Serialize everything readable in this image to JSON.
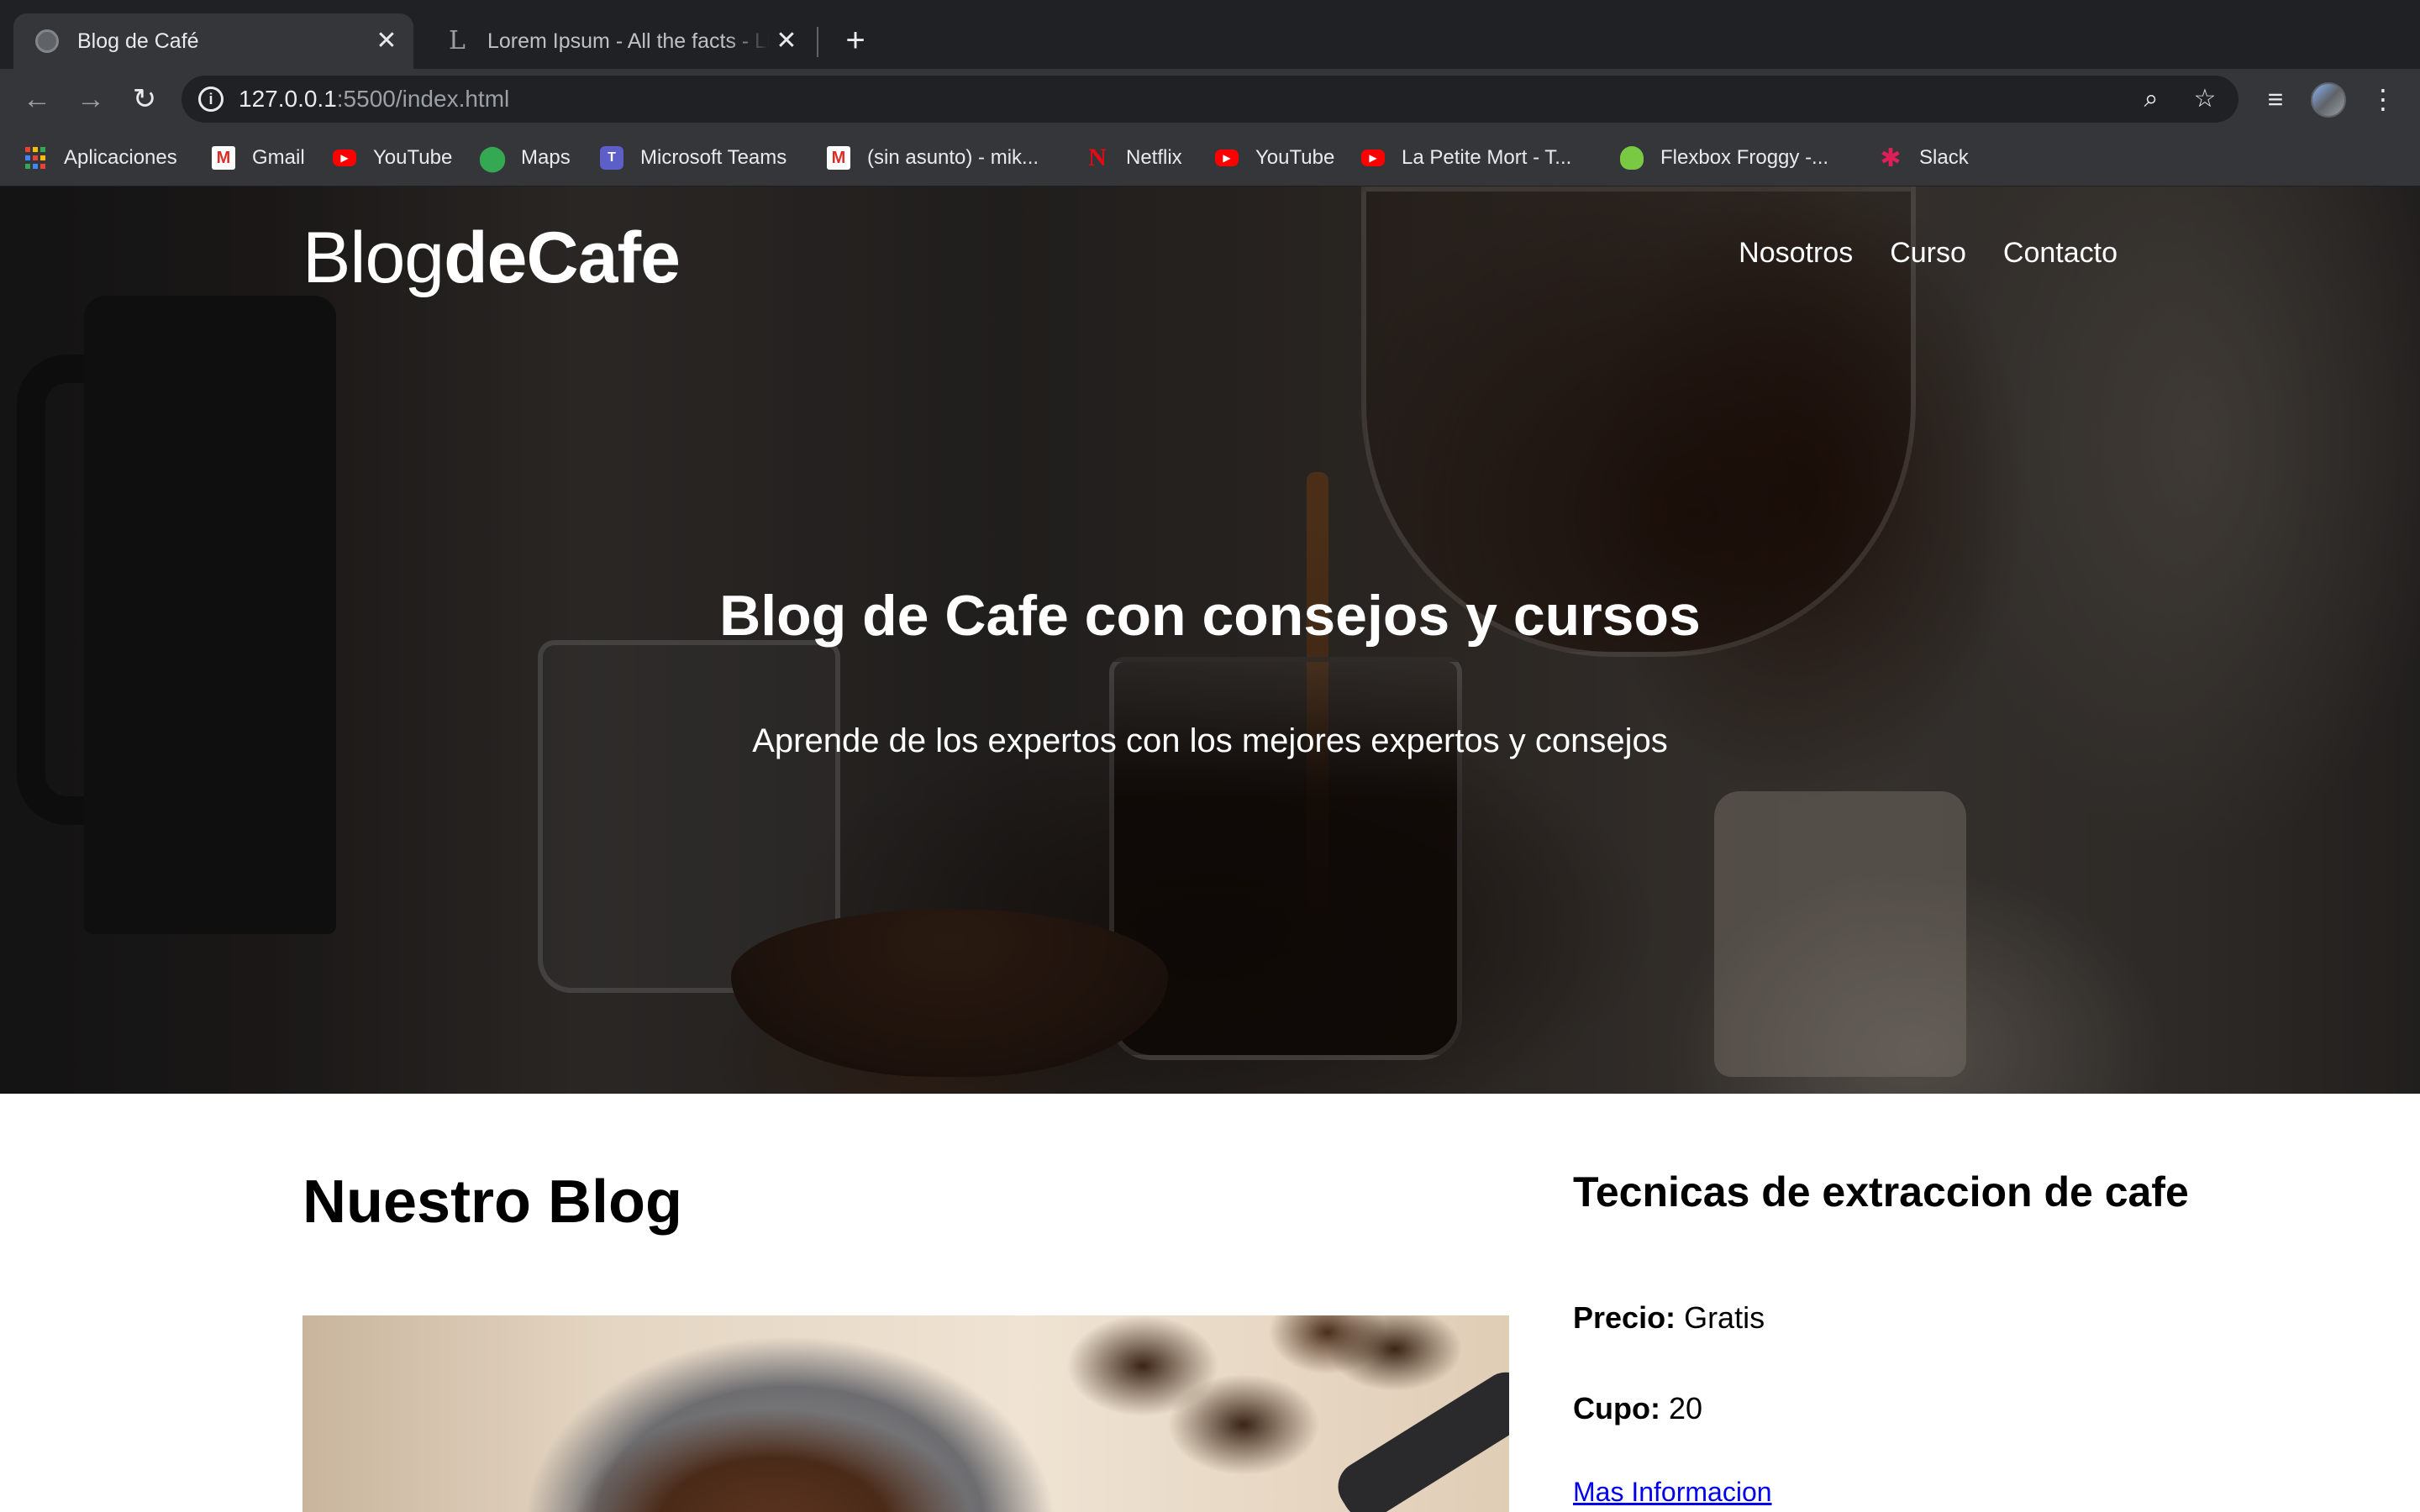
{
  "browser": {
    "tabs": [
      {
        "title": "Blog de Café",
        "active": true
      },
      {
        "title": "Lorem Ipsum - All the facts - Li",
        "active": false
      }
    ],
    "url_host": "127.0.0.1",
    "url_rest": ":5500/index.html",
    "bookmarks": [
      {
        "label": "Aplicaciones",
        "icon": "apps-grid-icon"
      },
      {
        "label": "Gmail",
        "icon": "gmail-icon"
      },
      {
        "label": "YouTube",
        "icon": "youtube-icon"
      },
      {
        "label": "Maps",
        "icon": "maps-icon"
      },
      {
        "label": "Microsoft Teams",
        "icon": "teams-icon"
      },
      {
        "label": "(sin asunto) - mik...",
        "icon": "gmail-icon"
      },
      {
        "label": "Netflix",
        "icon": "netflix-icon"
      },
      {
        "label": "YouTube",
        "icon": "youtube-icon"
      },
      {
        "label": "La Petite Mort - T...",
        "icon": "youtube-icon"
      },
      {
        "label": "Flexbox Froggy -...",
        "icon": "frog-icon"
      },
      {
        "label": "Slack",
        "icon": "slack-icon"
      }
    ]
  },
  "site": {
    "logo_light": "Blog",
    "logo_bold": "deCafe",
    "nav": [
      "Nosotros",
      "Curso",
      "Contacto"
    ],
    "hero_title": "Blog de Cafe con consejos y cursos",
    "hero_subtitle": "Aprende de los expertos con los mejores expertos y consejos",
    "blog_heading": "Nuestro Blog",
    "course": {
      "title": "Tecnicas de extraccion de cafe",
      "price_label": "Precio:",
      "price_value": "Gratis",
      "seats_label": "Cupo:",
      "seats_value": "20",
      "more_link": "Mas Informacion"
    }
  },
  "colors": {
    "tabstrip": "#202124",
    "toolbar": "#35363a",
    "link": "#0000ee"
  }
}
